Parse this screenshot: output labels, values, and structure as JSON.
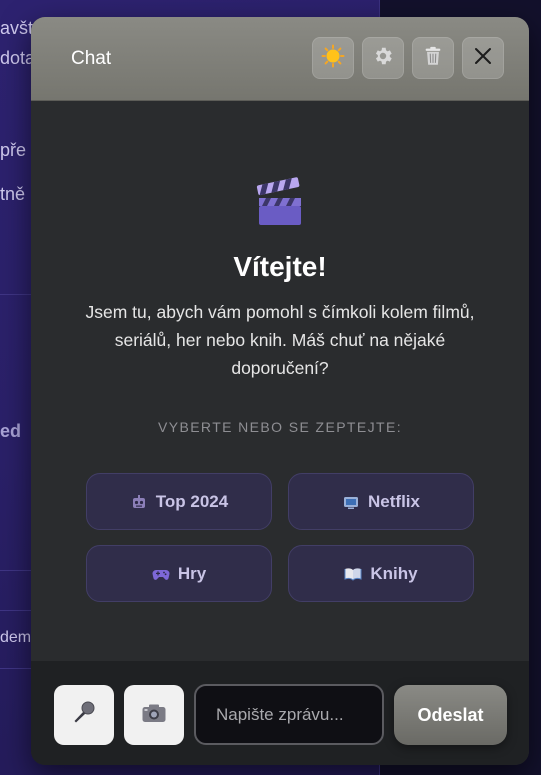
{
  "background": {
    "lines": [
      "avšt",
      "dota",
      "pře",
      "tně",
      "ed",
      "dem"
    ]
  },
  "chat": {
    "title": "Chat",
    "header_buttons": {
      "theme": "sun-icon",
      "settings": "gear-icon",
      "clear": "trash-icon",
      "close": "close-icon"
    },
    "welcome": {
      "icon": "clapperboard-icon",
      "title": "Vítejte!",
      "text": "Jsem tu, abych vám pomohl s čímkoli kolem filmů, seriálů, her nebo knih. Máš chuť na nějaké doporučení?"
    },
    "prompt_label": "VYBERTE NEBO SE ZEPTEJTE:",
    "quick_actions": [
      {
        "label": "Top 2024",
        "icon": "robot-icon"
      },
      {
        "label": "Netflix",
        "icon": "tv-icon"
      },
      {
        "label": "Hry",
        "icon": "gamepad-icon"
      },
      {
        "label": "Knihy",
        "icon": "book-icon"
      }
    ],
    "footer": {
      "mic_icon": "microphone-icon",
      "camera_icon": "camera-icon",
      "input_placeholder": "Napište zprávu...",
      "input_value": "",
      "send_label": "Odeslat"
    }
  },
  "colors": {
    "header": "#7f7f79",
    "body": "#2a2c2e",
    "quick_button_bg": "#302d4a",
    "quick_button_border": "#423e66",
    "background_page": "#2a2068"
  }
}
